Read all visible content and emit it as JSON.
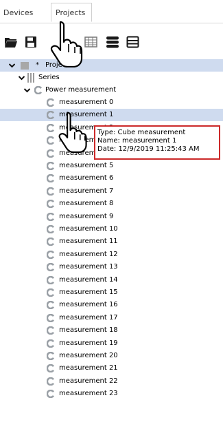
{
  "tabs": {
    "devices": "Devices",
    "projects": "Projects"
  },
  "toolbar": {
    "icons": [
      "folder-open-icon",
      "save-icon",
      "table-icon",
      "database-icon",
      "list-icon"
    ]
  },
  "tree": {
    "root": {
      "marker": "*",
      "label": "Projects"
    },
    "series": {
      "label": "Series"
    },
    "group": {
      "label": "Power measurement"
    },
    "items": [
      "measurement 0",
      "measurement 1",
      "measurement 2",
      "measurement 3",
      "measurement 4",
      "measurement 5",
      "measurement 6",
      "measurement 7",
      "measurement 8",
      "measurement 9",
      "measurement 10",
      "measurement 11",
      "measurement 12",
      "measurement 13",
      "measurement 14",
      "measurement 15",
      "measurement 16",
      "measurement 17",
      "measurement 18",
      "measurement 19",
      "measurement 20",
      "measurement 21",
      "measurement 22",
      "measurement 23"
    ],
    "selected_index": 1
  },
  "tooltip": {
    "type": "Type: Cube measurement",
    "name": "Name: measurement 1",
    "date": "Date: 12/9/2019 11:25:43 AM"
  },
  "colors": {
    "selection": "#cfdbef",
    "tooltip_border": "#cc2a2a",
    "c_icon": "#9aa0a6"
  }
}
